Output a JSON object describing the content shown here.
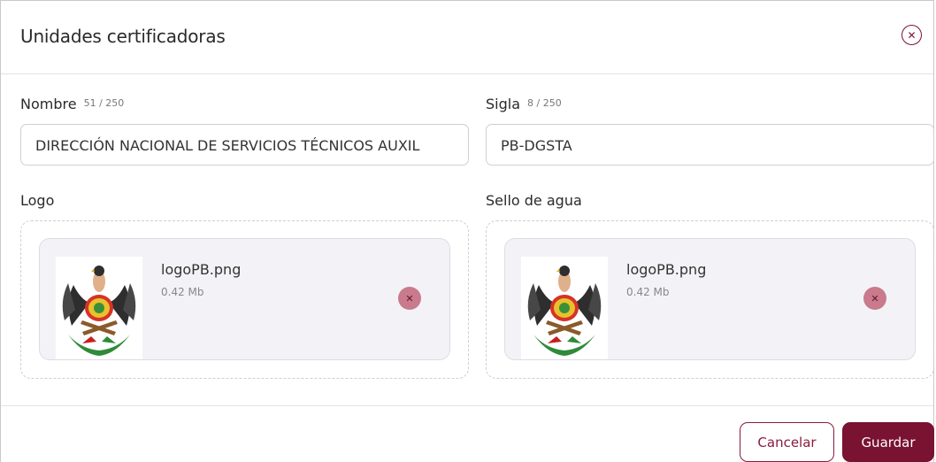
{
  "dialog": {
    "title": "Unidades certificadoras",
    "close_icon": "close-icon"
  },
  "form": {
    "nombre": {
      "label": "Nombre",
      "counter": "51 / 250",
      "value": "DIRECCIÓN NACIONAL DE SERVICIOS TÉCNICOS AUXIL"
    },
    "sigla": {
      "label": "Sigla",
      "counter": "8 / 250",
      "value": "PB-DGSTA"
    },
    "logo": {
      "label": "Logo",
      "file_name": "logoPB.png",
      "file_size": "0.42 Mb"
    },
    "sello": {
      "label": "Sello de agua",
      "file_name": "logoPB.png",
      "file_size": "0.42 Mb"
    }
  },
  "footer": {
    "cancel_label": "Cancelar",
    "save_label": "Guardar"
  },
  "colors": {
    "accent": "#7a1232",
    "remove_button": "#c97a8d",
    "card_background": "#f3f3f7"
  }
}
